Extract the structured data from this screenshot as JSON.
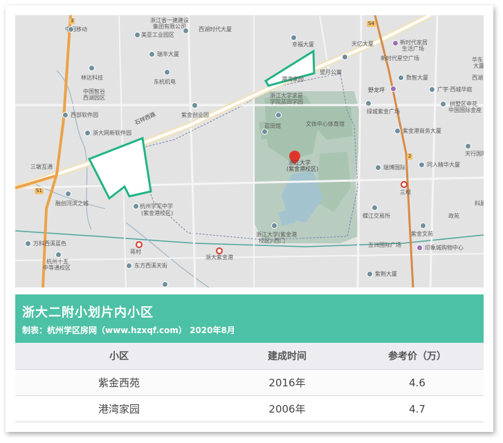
{
  "map": {
    "labels": [
      {
        "text": "中国移动"
      },
      {
        "text": "浙江省一建建设"
      },
      {
        "text": "集团有限公司"
      },
      {
        "text": "美亚工业园区"
      },
      {
        "text": "西湖时代大厦"
      },
      {
        "text": "瑞丰大厦"
      },
      {
        "text": "林达科技"
      },
      {
        "text": "东杭机电"
      },
      {
        "text": "中国智谷"
      },
      {
        "text": "西湖园区"
      },
      {
        "text": "西部软件园"
      },
      {
        "text": "浙大网新软件园"
      },
      {
        "text": "石祥西路"
      },
      {
        "text": "紫金创业园"
      },
      {
        "text": "三墩互通"
      },
      {
        "text": "杭州学军中学"
      },
      {
        "text": "(紫金港校区)"
      },
      {
        "text": "融创河滨之城"
      },
      {
        "text": "万科西溪蓝色"
      },
      {
        "text": "杭州十五"
      },
      {
        "text": "中等通校区"
      },
      {
        "text": "蒋村"
      },
      {
        "text": "东方西溪天街"
      },
      {
        "text": "浙大紫金港"
      },
      {
        "text": "港湾家园"
      },
      {
        "text": "望月公寓"
      },
      {
        "text": "浙江大学求是"
      },
      {
        "text": "学院蓝田学园"
      },
      {
        "text": "蓝田馆"
      },
      {
        "text": "文体中心体育馆"
      },
      {
        "text": "浙江大学"
      },
      {
        "text": "(紫金港校区)"
      },
      {
        "text": "浙江大学(紫金港"
      },
      {
        "text": "校区)-西门"
      },
      {
        "text": "幸福大厦"
      },
      {
        "text": "天亿大厦"
      },
      {
        "text": "新时代家居"
      },
      {
        "text": "生活广场"
      },
      {
        "text": "新时代星空广场"
      },
      {
        "text": "野龙坪"
      },
      {
        "text": "数智大厦"
      },
      {
        "text": "绿城紫金广场"
      },
      {
        "text": "广宇·西城华庭"
      },
      {
        "text": "拱墅区申花"
      },
      {
        "text": "中国国际金座"
      },
      {
        "text": "紫金港商务大厦"
      },
      {
        "text": "天行国际"
      },
      {
        "text": "同人精华大厦"
      },
      {
        "text": "瑞博国际"
      },
      {
        "text": "三坝"
      },
      {
        "text": "政苑"
      },
      {
        "text": "蝶江交易所"
      },
      {
        "text": "紫金文苑"
      },
      {
        "text": "五洲国际广场"
      },
      {
        "text": "印象城购物中心"
      },
      {
        "text": "紫荆大厦"
      },
      {
        "text": "华东"
      },
      {
        "text": "大厦"
      },
      {
        "text": "西湖"
      },
      {
        "text": "科展"
      }
    ],
    "road_tags": [
      {
        "text": "S1"
      },
      {
        "text": "S4"
      },
      {
        "text": "3"
      },
      {
        "text": "2"
      }
    ],
    "pin_label": "1"
  },
  "header": {
    "title": "浙大二附小划片内小区",
    "subtitle": "制表：杭州学区房网（www.hzxqf.com） 2020年8月"
  },
  "table": {
    "columns": [
      "小区",
      "建成时间",
      "参考价（万）"
    ],
    "rows": [
      [
        "紫金西苑",
        "2016年",
        "4.6"
      ],
      [
        "港湾家园",
        "2006年",
        "4.7"
      ]
    ]
  },
  "colors": {
    "header_bg": "#4dc1a6",
    "boundary": "#21b386",
    "table_head_bg": "#ececf1"
  }
}
